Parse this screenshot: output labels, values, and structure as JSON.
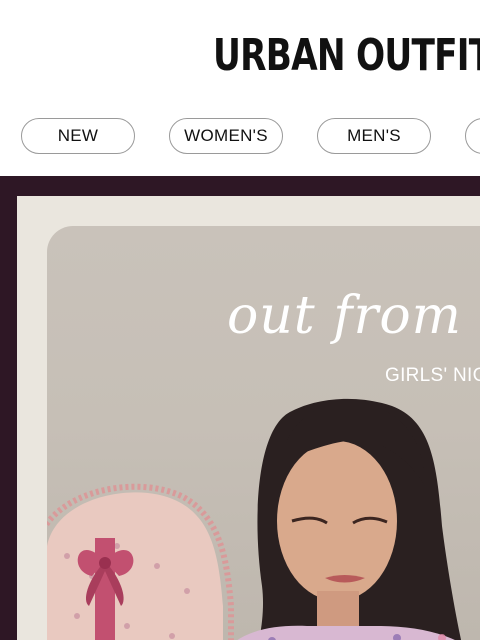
{
  "header": {
    "logo": "URBAN OUTFITTI"
  },
  "nav": {
    "items": [
      {
        "label": "NEW"
      },
      {
        "label": "WOMEN'S"
      },
      {
        "label": "MEN'S"
      },
      {
        "label": ""
      }
    ]
  },
  "hero": {
    "script_text": "out from un",
    "subhead": "GIRLS' NIGHT"
  },
  "colors": {
    "hero_background": "#2e1725",
    "card_background": "#eae6de",
    "accent_bow": "#c25070"
  }
}
